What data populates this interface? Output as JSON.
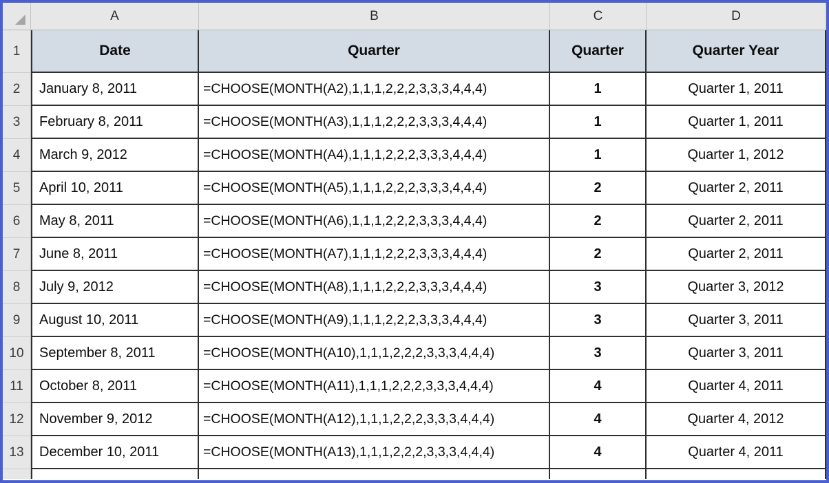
{
  "spreadsheet": {
    "select_all_icon": "select-all-triangle-icon",
    "column_letters": [
      "A",
      "B",
      "C",
      "D"
    ],
    "row_numbers": [
      "1",
      "2",
      "3",
      "4",
      "5",
      "6",
      "7",
      "8",
      "9",
      "10",
      "11",
      "12",
      "13"
    ],
    "header_row": {
      "a": "Date",
      "b": "Quarter",
      "c": "Quarter",
      "d": "Quarter Year"
    },
    "rows": [
      {
        "num": "2",
        "date": "January 8, 2011",
        "formula": "=CHOOSE(MONTH(A2),1,1,1,2,2,2,3,3,3,4,4,4)",
        "quarter": "1",
        "quarter_year": "Quarter 1, 2011"
      },
      {
        "num": "3",
        "date": "February 8, 2011",
        "formula": "=CHOOSE(MONTH(A3),1,1,1,2,2,2,3,3,3,4,4,4)",
        "quarter": "1",
        "quarter_year": "Quarter 1, 2011"
      },
      {
        "num": "4",
        "date": "March 9, 2012",
        "formula": "=CHOOSE(MONTH(A4),1,1,1,2,2,2,3,3,3,4,4,4)",
        "quarter": "1",
        "quarter_year": "Quarter 1, 2012"
      },
      {
        "num": "5",
        "date": "April 10, 2011",
        "formula": "=CHOOSE(MONTH(A5),1,1,1,2,2,2,3,3,3,4,4,4)",
        "quarter": "2",
        "quarter_year": "Quarter 2, 2011"
      },
      {
        "num": "6",
        "date": "May 8, 2011",
        "formula": "=CHOOSE(MONTH(A6),1,1,1,2,2,2,3,3,3,4,4,4)",
        "quarter": "2",
        "quarter_year": "Quarter 2, 2011"
      },
      {
        "num": "7",
        "date": "June 8, 2011",
        "formula": "=CHOOSE(MONTH(A7),1,1,1,2,2,2,3,3,3,4,4,4)",
        "quarter": "2",
        "quarter_year": "Quarter 2, 2011"
      },
      {
        "num": "8",
        "date": "July 9, 2012",
        "formula": "=CHOOSE(MONTH(A8),1,1,1,2,2,2,3,3,3,4,4,4)",
        "quarter": "3",
        "quarter_year": "Quarter 3, 2012"
      },
      {
        "num": "9",
        "date": "August 10, 2011",
        "formula": "=CHOOSE(MONTH(A9),1,1,1,2,2,2,3,3,3,4,4,4)",
        "quarter": "3",
        "quarter_year": "Quarter 3, 2011"
      },
      {
        "num": "10",
        "date": "September 8, 2011",
        "formula": "=CHOOSE(MONTH(A10),1,1,1,2,2,2,3,3,3,4,4,4)",
        "quarter": "3",
        "quarter_year": "Quarter 3, 2011"
      },
      {
        "num": "11",
        "date": "October 8, 2011",
        "formula": "=CHOOSE(MONTH(A11),1,1,1,2,2,2,3,3,3,4,4,4)",
        "quarter": "4",
        "quarter_year": "Quarter 4, 2011"
      },
      {
        "num": "12",
        "date": "November 9, 2012",
        "formula": "=CHOOSE(MONTH(A12),1,1,1,2,2,2,3,3,3,4,4,4)",
        "quarter": "4",
        "quarter_year": "Quarter 4, 2012"
      },
      {
        "num": "13",
        "date": "December 10, 2011",
        "formula": "=CHOOSE(MONTH(A13),1,1,1,2,2,2,3,3,3,4,4,4)",
        "quarter": "4",
        "quarter_year": "Quarter 4, 2011"
      }
    ],
    "colors": {
      "frame_border": "#4a5fd0",
      "header_fill": "#d3dbe5",
      "gutter_fill": "#e7e7e7",
      "gridline": "#2f2f2f"
    }
  }
}
